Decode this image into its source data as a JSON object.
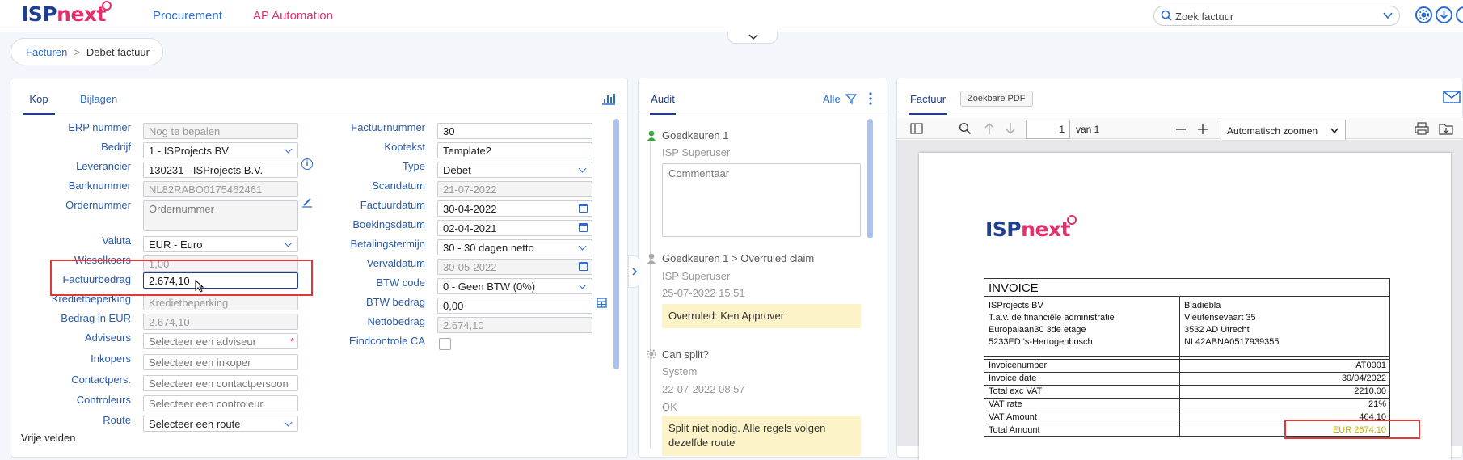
{
  "app": {
    "logo_left": "ISP",
    "logo_right": "next",
    "nav": [
      "Procurement",
      "AP Automation"
    ]
  },
  "search": {
    "placeholder": "Zoek factuur"
  },
  "breadcrumb": {
    "parent": "Facturen",
    "separator": ">",
    "current": "Debet factuur"
  },
  "left_panel": {
    "tabs": [
      "Kop",
      "Bijlagen"
    ],
    "fields_left": [
      {
        "label": "ERP nummer",
        "value": "Nog te bepalen",
        "state": "readonly"
      },
      {
        "label": "Bedrijf",
        "value": "1 - ISProjects BV",
        "state": "dropdown"
      },
      {
        "label": "Leverancier",
        "value": "130231 - ISProjects B.V.",
        "state": "edit"
      },
      {
        "label": "Banknummer",
        "value": "NL82RABO0175462461",
        "state": "readonly"
      },
      {
        "label": "Ordernummer",
        "value": "Ordernummer",
        "state": "textarea"
      },
      {
        "label": "Valuta",
        "value": "EUR - Euro",
        "state": "dropdown"
      },
      {
        "label": "Wisselkoers",
        "value": "1,00",
        "state": "readonly"
      },
      {
        "label": "Factuurbedrag",
        "value": "2.674,10",
        "state": "focused"
      },
      {
        "label": "Kredietbeperking",
        "value": "Kredietbeperking",
        "state": "readonly"
      },
      {
        "label": "Bedrag in EUR",
        "value": "2.674,10",
        "state": "readonly"
      },
      {
        "label": "Adviseurs",
        "value": "Selecteer een adviseur",
        "state": "placeholder"
      },
      {
        "label": "Inkopers",
        "value": "Selecteer een inkoper",
        "state": "placeholder"
      },
      {
        "label": "Contactpers.",
        "value": "Selecteer een contactpersoon",
        "state": "placeholder"
      },
      {
        "label": "Controleurs",
        "value": "Selecteer een controleur",
        "state": "placeholder"
      },
      {
        "label": "Route",
        "value": "Selecteer een route",
        "state": "dropdown"
      }
    ],
    "fields_right": [
      {
        "label": "Factuurnummer",
        "value": "30",
        "state": "edit"
      },
      {
        "label": "Koptekst",
        "value": "Template2",
        "state": "edit"
      },
      {
        "label": "Type",
        "value": "Debet",
        "state": "dropdown"
      },
      {
        "label": "Scandatum",
        "value": "21-07-2022",
        "state": "readonly"
      },
      {
        "label": "Factuurdatum",
        "value": "30-04-2022",
        "state": "date"
      },
      {
        "label": "Boekingsdatum",
        "value": "02-04-2021",
        "state": "date"
      },
      {
        "label": "Betalingstermijn",
        "value": "30 - 30 dagen netto",
        "state": "dropdown"
      },
      {
        "label": "Vervaldatum",
        "value": "30-05-2022",
        "state": "readonly-date"
      },
      {
        "label": "BTW code",
        "value": "0 - Geen BTW (0%)",
        "state": "dropdown"
      },
      {
        "label": "BTW bedrag",
        "value": "0,00",
        "state": "edit"
      },
      {
        "label": "Nettobedrag",
        "value": "2.674,10",
        "state": "readonly"
      },
      {
        "label": "Eindcontrole CA",
        "value": "",
        "state": "checkbox"
      }
    ],
    "extra_section": "Vrije velden"
  },
  "audit": {
    "tab": "Audit",
    "filter": "Alle",
    "entries": [
      {
        "title": "Goedkeuren 1",
        "user": "ISP Superuser",
        "comment_placeholder": "Commentaar",
        "icon": "user-green"
      },
      {
        "title": "Goedkeuren 1 > Overruled claim",
        "user": "ISP Superuser",
        "date": "25-07-2022 15:51",
        "note": "Overruled: Ken Approver",
        "icon": "user-gray"
      },
      {
        "title": "Can split?",
        "user": "System",
        "date": "22-07-2022 08:57",
        "status": "OK",
        "note": "Split niet nodig. Alle regels volgen dezelfde route",
        "icon": "gear-gray"
      }
    ]
  },
  "pdf": {
    "tabs": [
      "Factuur",
      "Zoekbare PDF"
    ],
    "page_current": "1",
    "page_total_label": "van 1",
    "zoom": "Automatisch zoomen",
    "invoice": {
      "title": "INVOICE",
      "from": [
        "ISProjects BV",
        "T.a.v. de financiële administratie",
        "Europalaan30 3de etage",
        "5233ED 's-Hertogenbosch"
      ],
      "to": [
        "Bladiebla",
        "Vleutensevaart 35",
        "3532 AD Utrecht",
        "NL42ABNA0517939355"
      ],
      "rows": [
        {
          "label": "Invoicenumber",
          "value": "AT0001"
        },
        {
          "label": "Invoice date",
          "value": "30/04/2022"
        },
        {
          "label": "Total exc VAT",
          "value": "2210.00"
        },
        {
          "label": "VAT rate",
          "value": "21%"
        },
        {
          "label": "VAT Amount",
          "value": "464.10"
        },
        {
          "label": "Total Amount",
          "value": "EUR  2674.10"
        }
      ]
    }
  },
  "colors": {
    "brand_blue": "#1e3f8f",
    "brand_pink": "#e1306c",
    "link": "#2a6bcf",
    "highlight_red": "#e0393b",
    "note_bg": "#fdf3c8"
  }
}
